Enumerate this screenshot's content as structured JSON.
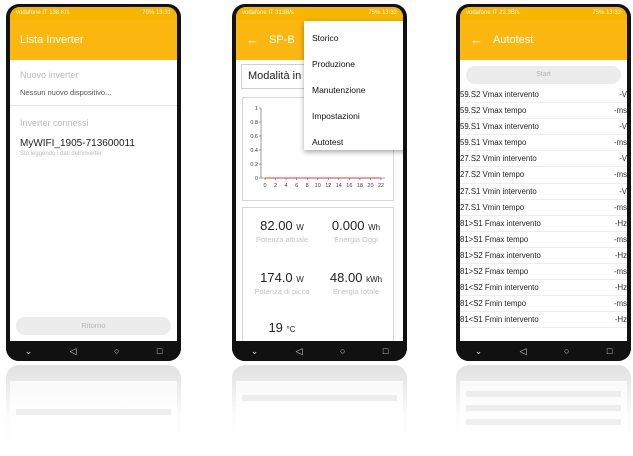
{
  "phone1": {
    "status": "vodafone IT 138 K/s",
    "status_right": "79% 13:31",
    "title": "Lista Inverter",
    "new_section": "Nuovo inverter",
    "no_new": "Nessun nuovo dispositivo...",
    "connected_section": "Inverter connessi",
    "inverter_name": "MyWIFI_1905-713600011",
    "inverter_status": "Sto leggendo i dati dell'inverter",
    "back_button": "Ritorno"
  },
  "phone2": {
    "status": "vodafone IT 313B/s",
    "status_right": "75% 13:32",
    "title": "SP-B",
    "selector": "Modalità in",
    "chart_data": {
      "type": "line",
      "x_ticks": [
        "0",
        "2",
        "4",
        "6",
        "8",
        "10",
        "12",
        "14",
        "16",
        "18",
        "20",
        "22"
      ],
      "y_ticks": [
        "0",
        "0.2",
        "0.4",
        "0.6",
        "0.8",
        "1"
      ],
      "ylim": [
        0,
        1
      ],
      "values": [
        0,
        0,
        0,
        0,
        0,
        0,
        0,
        0,
        0,
        0,
        0,
        0
      ]
    },
    "stats": {
      "power_now_value": "82.00",
      "power_now_unit": "W",
      "power_now_label": "Potenza attuale",
      "energy_today_value": "0.000",
      "energy_today_unit": "Wh",
      "energy_today_label": "Energia Oggi",
      "peak_power_value": "174.0",
      "peak_power_unit": "W",
      "peak_power_label": "Potenza di picco",
      "energy_total_value": "48.00",
      "energy_total_unit": "kWh",
      "energy_total_label": "Energia totale",
      "temp_value": "19",
      "temp_unit": "°C"
    },
    "menu": [
      "Storico",
      "Produzione",
      "Manutenzione",
      "Impostazioni",
      "Autotest"
    ]
  },
  "phone3": {
    "status": "vodafone IT 22.3B/s",
    "status_right": "75% 13:32",
    "title": "Autotest",
    "start_button": "Start",
    "rows": [
      {
        "label": "59.S2 Vmax intervento",
        "unit": "-V"
      },
      {
        "label": "59.S2 Vmax tempo",
        "unit": "-ms"
      },
      {
        "label": "59.S1 Vmax intervento",
        "unit": "-V"
      },
      {
        "label": "59.S1 Vmax tempo",
        "unit": "-ms"
      },
      {
        "label": "27.S2 Vmin intervento",
        "unit": "-V"
      },
      {
        "label": "27.S2 Vmin tempo",
        "unit": "-ms"
      },
      {
        "label": "27.S1 Vmin intervento",
        "unit": "-V"
      },
      {
        "label": "27.S1 Vmin tempo",
        "unit": "-ms"
      },
      {
        "label": "81>S1 Fmax intervento",
        "unit": "-Hz"
      },
      {
        "label": "81>S1 Fmax tempo",
        "unit": "-ms"
      },
      {
        "label": "81>S2 Fmax intervento",
        "unit": "-Hz"
      },
      {
        "label": "81>S2 Fmax tempo",
        "unit": "-ms"
      },
      {
        "label": "81<S2 Fmin intervento",
        "unit": "-Hz"
      },
      {
        "label": "81<S2 Fmin tempo",
        "unit": "-ms"
      },
      {
        "label": "81<S1 Fmin intervento",
        "unit": "-Hz"
      }
    ]
  },
  "nav": {
    "back": "◁",
    "home": "○",
    "recents": "□",
    "down": "⌄"
  },
  "colors": {
    "accent": "#fbb710",
    "statusbar": "#f7b500"
  }
}
